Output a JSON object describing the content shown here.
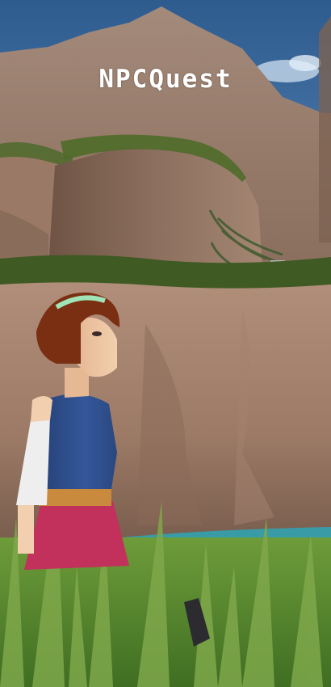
{
  "game": {
    "title": "NPCQuest"
  },
  "colors": {
    "sky": "#3f6a9a",
    "cliff": "#a88774",
    "grass": "#5f8f2e",
    "hair": "#7a2e12",
    "top": "#2f4e8a",
    "skirt": "#c2305c"
  }
}
